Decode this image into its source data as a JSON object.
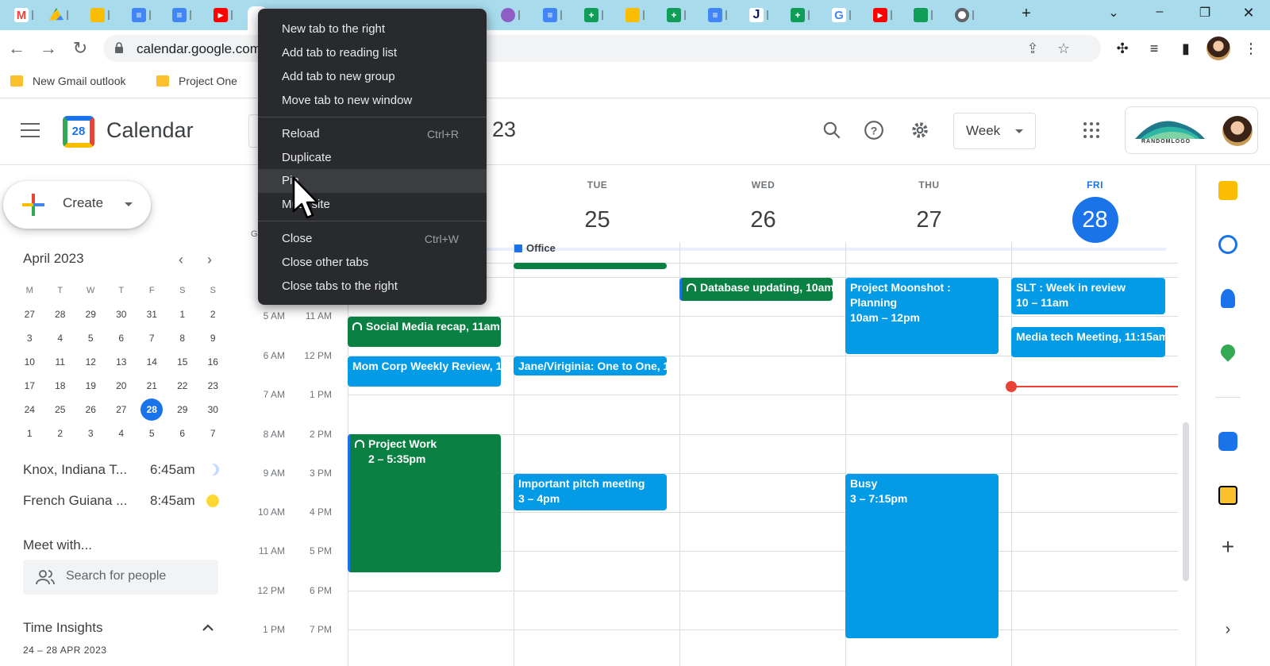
{
  "browser": {
    "url": "calendar.google.com",
    "bookmarks": [
      "New Gmail outlook",
      "Project One"
    ]
  },
  "calendar": {
    "app_title": "Calendar",
    "logo_day": "28",
    "header_date_partial": "23",
    "view": "Week",
    "brand_logo_text": "RANDOMLOGO"
  },
  "sidebar": {
    "create_label": "Create",
    "mini_month": "April 2023",
    "weekdays": [
      "M",
      "T",
      "W",
      "T",
      "F",
      "S",
      "S"
    ],
    "weeks": [
      [
        "27",
        "28",
        "29",
        "30",
        "31",
        "1",
        "2"
      ],
      [
        "3",
        "4",
        "5",
        "6",
        "7",
        "8",
        "9"
      ],
      [
        "10",
        "11",
        "12",
        "13",
        "14",
        "15",
        "16"
      ],
      [
        "17",
        "18",
        "19",
        "20",
        "21",
        "22",
        "23"
      ],
      [
        "24",
        "25",
        "26",
        "27",
        "28",
        "29",
        "30"
      ],
      [
        "1",
        "2",
        "3",
        "4",
        "5",
        "6",
        "7"
      ]
    ],
    "today": "28",
    "timezones": [
      {
        "name": "Knox, Indiana T...",
        "time": "6:45am",
        "icon": "moon-icon"
      },
      {
        "name": "French Guiana ...",
        "time": "8:45am",
        "icon": "sun-icon"
      }
    ],
    "meet_title": "Meet with...",
    "people_placeholder": "Search for people",
    "insights_title": "Time Insights",
    "insights_range": "24 – 28 APR 2023"
  },
  "days": [
    {
      "name": "TUE",
      "num": "25"
    },
    {
      "name": "WED",
      "num": "26"
    },
    {
      "name": "THU",
      "num": "27"
    },
    {
      "name": "FRI",
      "num": "28",
      "today": true
    }
  ],
  "allday": {
    "label": "Office"
  },
  "time_labels_primary": [
    "5 AM",
    "6 AM",
    "7 AM",
    "8 AM",
    "9 AM",
    "10 AM",
    "11 AM",
    "12 PM",
    "1 PM"
  ],
  "time_labels_secondary": [
    "11 AM",
    "12 PM",
    "1 PM",
    "2 PM",
    "3 PM",
    "4 PM",
    "5 PM",
    "6 PM",
    "7 PM"
  ],
  "gutter_partial": "G",
  "events": [
    {
      "title": "Social Media recap, 11am",
      "time": ""
    },
    {
      "title": "Mom Corp Weekly Review, 1",
      "time": ""
    },
    {
      "title": "Project Work",
      "time": "2 – 5:35pm"
    },
    {
      "title": "Jane/Viriginia: One to One, 1",
      "time": ""
    },
    {
      "title": "Important pitch meeting",
      "time": "3 – 4pm"
    },
    {
      "title": "Database updating, 10am",
      "time": ""
    },
    {
      "title": "Project Moonshot :",
      "title2": "Planning",
      "time": "10am – 12pm"
    },
    {
      "title": "Busy",
      "time": "3 – 7:15pm"
    },
    {
      "title": "SLT : Week in review",
      "time": "10 – 11am"
    },
    {
      "title": "Media tech Meeting, 11:15am",
      "time": ""
    }
  ],
  "context_menu": {
    "items": [
      {
        "label": "New tab to the right",
        "shortcut": ""
      },
      {
        "label": "Add tab to reading list",
        "shortcut": ""
      },
      {
        "label": "Add tab to new group",
        "shortcut": ""
      },
      {
        "label": "Move tab to new window",
        "shortcut": ""
      },
      {
        "label": "Reload",
        "shortcut": "Ctrl+R"
      },
      {
        "label": "Duplicate",
        "shortcut": ""
      },
      {
        "label": "Pin",
        "shortcut": ""
      },
      {
        "label": "Mute site",
        "shortcut": ""
      },
      {
        "label": "Close",
        "shortcut": "Ctrl+W"
      },
      {
        "label": "Close other tabs",
        "shortcut": ""
      },
      {
        "label": "Close tabs to the right",
        "shortcut": ""
      }
    ]
  },
  "colors": {
    "accent": "#1a73e8",
    "event_green": "#0b8043",
    "event_blue": "#039be5",
    "now_line": "#ea4335",
    "tabstrip": "#a8dcec",
    "menu_bg": "#292a2d"
  }
}
